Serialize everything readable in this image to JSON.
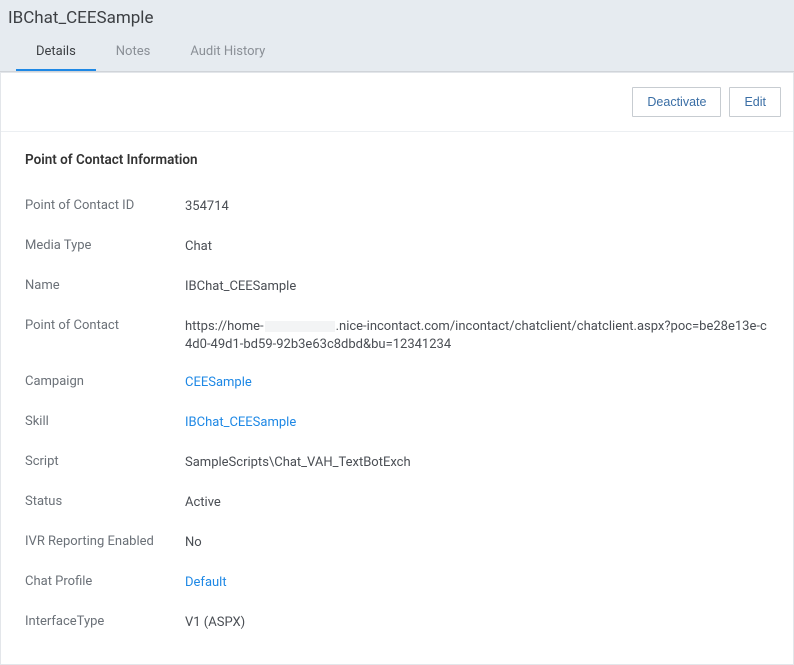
{
  "header": {
    "title": "IBChat_CEESample"
  },
  "tabs": [
    {
      "label": "Details",
      "active": true
    },
    {
      "label": "Notes",
      "active": false
    },
    {
      "label": "Audit History",
      "active": false
    }
  ],
  "toolbar": {
    "deactivate_label": "Deactivate",
    "edit_label": "Edit"
  },
  "section": {
    "title": "Point of Contact Information",
    "fields": {
      "poc_id": {
        "label": "Point of Contact ID",
        "value": "354714"
      },
      "media_type": {
        "label": "Media Type",
        "value": "Chat"
      },
      "name": {
        "label": "Name",
        "value": "IBChat_CEESample"
      },
      "poc": {
        "label": "Point of Contact",
        "value_prefix": "https://home-",
        "value_suffix": ".nice-incontact.com/incontact/chatclient/chatclient.aspx?poc=be28e13e-c4d0-49d1-bd59-92b3e63c8dbd&bu=12341234"
      },
      "campaign": {
        "label": "Campaign",
        "value": "CEESample"
      },
      "skill": {
        "label": "Skill",
        "value": "IBChat_CEESample"
      },
      "script": {
        "label": "Script",
        "value": "SampleScripts\\Chat_VAH_TextBotExch"
      },
      "status": {
        "label": "Status",
        "value": "Active"
      },
      "ivr": {
        "label": "IVR Reporting Enabled",
        "value": "No"
      },
      "chat_profile": {
        "label": "Chat Profile",
        "value": "Default"
      },
      "interface_type": {
        "label": "InterfaceType",
        "value": "V1 (ASPX)"
      }
    }
  }
}
